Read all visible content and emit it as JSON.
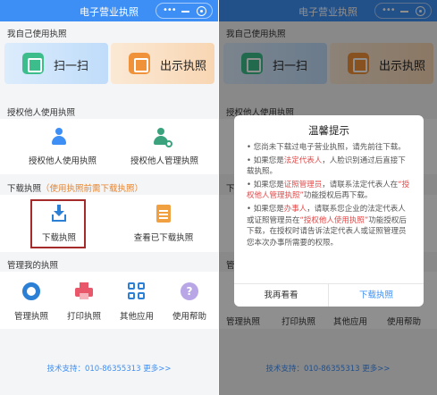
{
  "app": {
    "title": "电子营业执照",
    "capsule_dots": "•••"
  },
  "sections": {
    "mine": "我自己使用执照",
    "authorize": "授权他人使用执照",
    "download": "下载执照",
    "download_note": "（使用执照前需下载执照）",
    "manage": "管理我的执照"
  },
  "cards": {
    "scan": "扫一扫",
    "show": "出示执照"
  },
  "authorize_items": {
    "use": "授权他人使用执照",
    "manage": "授权他人管理执照"
  },
  "download_items": {
    "download": "下载执照",
    "view": "查看已下载执照"
  },
  "manage_items": {
    "manage": "管理执照",
    "print": "打印执照",
    "other": "其他应用",
    "help": "使用帮助",
    "help_glyph": "?"
  },
  "footer": {
    "support": "技术支持：010-86355313",
    "more": "更多>>"
  },
  "modal": {
    "title": "温馨提示",
    "p1": "• 您尚未下载过电子营业执照，请先前往下载。",
    "p2_a": "• 如果您是",
    "p2_role": "法定代表人",
    "p2_b": "，人脸识别通过后直接下载执照。",
    "p3_a": "• 如果您是",
    "p3_role": "证照管理员",
    "p3_b": "，请联系法定代表人在",
    "p3_func": "“授权他人管理执照”",
    "p3_c": "功能授权后再下载。",
    "p4_a": "• 如果您是",
    "p4_role": "办事人",
    "p4_b": "，请联系您企业的法定代表人或证照管理员在",
    "p4_func": "“授权他人使用执照”",
    "p4_c": "功能授权后下载，在授权时请告诉法定代表人或证照管理员您本次办事所需要的权限。",
    "cancel": "我再看看",
    "ok": "下载执照"
  },
  "colors": {
    "primary": "#3d8ff5",
    "accent_orange": "#e8842c",
    "highlight_red": "#a52a2a",
    "modal_red": "#e24a4a"
  }
}
